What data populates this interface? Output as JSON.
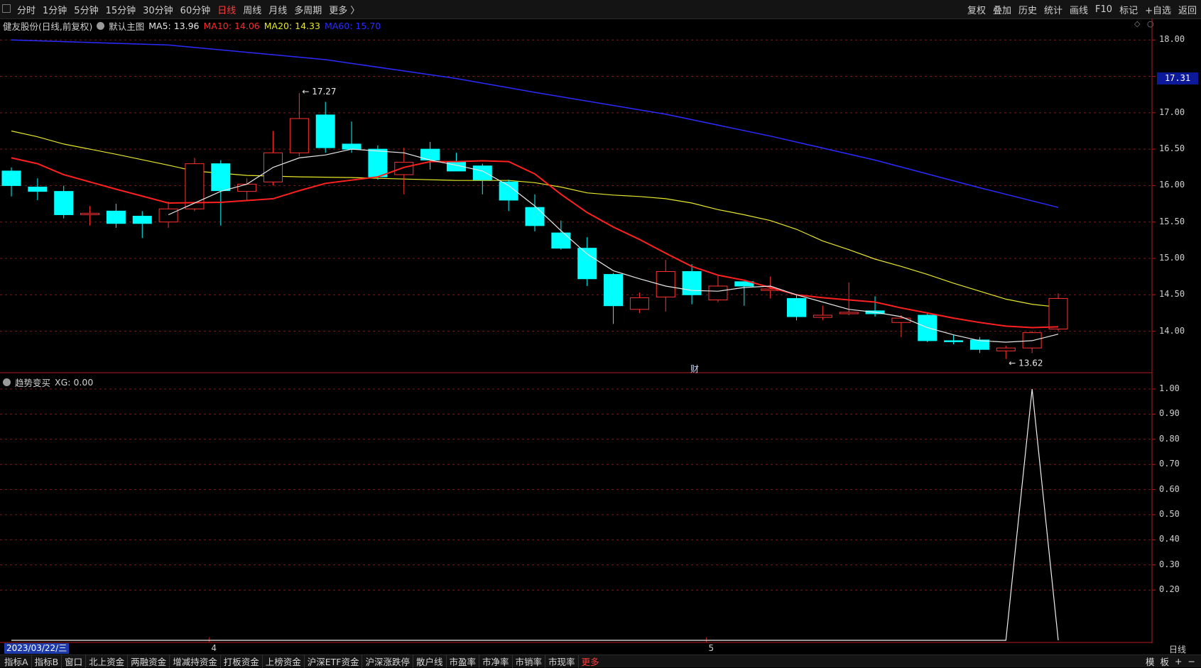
{
  "toolbar": {
    "periods": [
      "分时",
      "1分钟",
      "5分钟",
      "15分钟",
      "30分钟",
      "60分钟",
      "日线",
      "周线",
      "月线",
      "多周期",
      "更多 〉"
    ],
    "active_period": "日线",
    "tools": [
      "复权",
      "叠加",
      "历史",
      "统计",
      "画线",
      "F10",
      "标记",
      "+自选",
      "返回"
    ]
  },
  "info": {
    "stock": "健友股份(日线,前复权)",
    "template": "默认主图",
    "ma": [
      {
        "label": "MA5: 13.96",
        "color": "#e8e8e8"
      },
      {
        "label": "MA10: 14.06",
        "color": "#ff2a2a"
      },
      {
        "label": "MA20: 14.33",
        "color": "#e6e62a"
      },
      {
        "label": "MA60: 15.70",
        "color": "#2b2bff"
      }
    ]
  },
  "side_icons": [
    "◇",
    "○"
  ],
  "sub": {
    "name": "趋势变买",
    "value": "XG: 0.00"
  },
  "badge": "财",
  "price_axis": [
    "18.00",
    "17.50",
    "17.00",
    "16.50",
    "16.00",
    "15.50",
    "15.00",
    "14.50",
    "14.00"
  ],
  "current_price": "17.31",
  "sub_axis": [
    "1.00",
    "0.90",
    "0.80",
    "0.70",
    "0.60",
    "0.50",
    "0.40",
    "0.30",
    "0.20"
  ],
  "annotations": {
    "high": "17.27",
    "low": "13.62"
  },
  "month_marks": [
    "4",
    "5"
  ],
  "cursor_date": "2023/03/22/三",
  "period_tag": "日线",
  "bottom": {
    "tabs": [
      "指标A",
      "指标B",
      "窗口",
      "北上资金",
      "两融资金",
      "增减持资金",
      "打板资金",
      "上榜资金",
      "沪深ETF资金",
      "沪深涨跌停",
      "散户线",
      "市盈率",
      "市净率",
      "市销率",
      "市现率"
    ],
    "more": "更多",
    "right": [
      "模",
      "板",
      "+",
      "−"
    ]
  },
  "colors": {
    "up": "#ff3232",
    "down": "#00ffff",
    "ma5": "#e8e8e8",
    "ma10": "#ff2020",
    "ma20": "#e6e62a",
    "ma60": "#2b2bff",
    "grid": "#7a1a1a"
  },
  "chart_data": {
    "type": "candlestick",
    "y_range": [
      13.45,
      18.1
    ],
    "candles": [
      {
        "o": 16.2,
        "h": 16.25,
        "l": 15.85,
        "c": 16.0
      },
      {
        "o": 15.98,
        "h": 16.1,
        "l": 15.8,
        "c": 15.92
      },
      {
        "o": 15.92,
        "h": 16.0,
        "l": 15.55,
        "c": 15.6
      },
      {
        "o": 15.6,
        "h": 15.72,
        "l": 15.45,
        "c": 15.62
      },
      {
        "o": 15.65,
        "h": 15.75,
        "l": 15.42,
        "c": 15.48
      },
      {
        "o": 15.58,
        "h": 15.65,
        "l": 15.28,
        "c": 15.48
      },
      {
        "o": 15.5,
        "h": 15.78,
        "l": 15.42,
        "c": 15.68
      },
      {
        "o": 15.68,
        "h": 16.38,
        "l": 15.65,
        "c": 16.3
      },
      {
        "o": 16.3,
        "h": 16.35,
        "l": 15.45,
        "c": 15.93
      },
      {
        "o": 15.92,
        "h": 16.1,
        "l": 15.8,
        "c": 16.02
      },
      {
        "o": 16.05,
        "h": 16.75,
        "l": 16.0,
        "c": 16.45
      },
      {
        "o": 16.45,
        "h": 17.27,
        "l": 16.4,
        "c": 16.92
      },
      {
        "o": 16.97,
        "h": 17.15,
        "l": 16.45,
        "c": 16.52
      },
      {
        "o": 16.57,
        "h": 16.88,
        "l": 16.45,
        "c": 16.5
      },
      {
        "o": 16.5,
        "h": 16.55,
        "l": 16.08,
        "c": 16.12
      },
      {
        "o": 16.15,
        "h": 16.52,
        "l": 15.88,
        "c": 16.32
      },
      {
        "o": 16.5,
        "h": 16.6,
        "l": 16.22,
        "c": 16.35
      },
      {
        "o": 16.33,
        "h": 16.45,
        "l": 16.2,
        "c": 16.2
      },
      {
        "o": 16.27,
        "h": 16.3,
        "l": 15.88,
        "c": 16.08
      },
      {
        "o": 16.05,
        "h": 16.08,
        "l": 15.65,
        "c": 15.8
      },
      {
        "o": 15.7,
        "h": 15.88,
        "l": 15.37,
        "c": 15.45
      },
      {
        "o": 15.35,
        "h": 15.52,
        "l": 15.12,
        "c": 15.14
      },
      {
        "o": 15.14,
        "h": 15.29,
        "l": 14.62,
        "c": 14.72
      },
      {
        "o": 14.78,
        "h": 14.8,
        "l": 14.1,
        "c": 14.35
      },
      {
        "o": 14.3,
        "h": 14.53,
        "l": 14.25,
        "c": 14.46
      },
      {
        "o": 14.47,
        "h": 14.98,
        "l": 14.27,
        "c": 14.82
      },
      {
        "o": 14.82,
        "h": 14.92,
        "l": 14.37,
        "c": 14.5
      },
      {
        "o": 14.43,
        "h": 14.76,
        "l": 14.4,
        "c": 14.62
      },
      {
        "o": 14.68,
        "h": 14.68,
        "l": 14.35,
        "c": 14.62
      },
      {
        "o": 14.56,
        "h": 14.75,
        "l": 14.45,
        "c": 14.58
      },
      {
        "o": 14.45,
        "h": 14.5,
        "l": 14.15,
        "c": 14.2
      },
      {
        "o": 14.19,
        "h": 14.35,
        "l": 14.15,
        "c": 14.22
      },
      {
        "o": 14.24,
        "h": 14.67,
        "l": 14.22,
        "c": 14.26
      },
      {
        "o": 14.28,
        "h": 14.48,
        "l": 14.2,
        "c": 14.24
      },
      {
        "o": 14.12,
        "h": 14.22,
        "l": 13.92,
        "c": 14.18
      },
      {
        "o": 14.22,
        "h": 14.25,
        "l": 13.85,
        "c": 13.87
      },
      {
        "o": 13.87,
        "h": 13.95,
        "l": 13.82,
        "c": 13.86
      },
      {
        "o": 13.88,
        "h": 13.92,
        "l": 13.7,
        "c": 13.75
      },
      {
        "o": 13.73,
        "h": 13.8,
        "l": 13.62,
        "c": 13.77
      },
      {
        "o": 13.77,
        "h": 14.0,
        "l": 13.7,
        "c": 13.98
      },
      {
        "o": 14.03,
        "h": 14.52,
        "l": 14.0,
        "c": 14.45
      }
    ],
    "ma5": [
      [
        6,
        15.6
      ],
      [
        8,
        15.92
      ],
      [
        9,
        16.02
      ],
      [
        10,
        16.25
      ],
      [
        11,
        16.38
      ],
      [
        12,
        16.42
      ],
      [
        13,
        16.5
      ],
      [
        15,
        16.45
      ],
      [
        16,
        16.35
      ],
      [
        17,
        16.28
      ],
      [
        18,
        16.2
      ],
      [
        19,
        16.0
      ],
      [
        20,
        15.72
      ],
      [
        21,
        15.38
      ],
      [
        22,
        15.06
      ],
      [
        23,
        14.83
      ],
      [
        24,
        14.72
      ],
      [
        25,
        14.62
      ],
      [
        26,
        14.56
      ],
      [
        27,
        14.55
      ],
      [
        28,
        14.6
      ],
      [
        29,
        14.62
      ],
      [
        30,
        14.5
      ],
      [
        31,
        14.4
      ],
      [
        32,
        14.3
      ],
      [
        33,
        14.26
      ],
      [
        34,
        14.2
      ],
      [
        35,
        14.05
      ],
      [
        36,
        13.95
      ],
      [
        37,
        13.87
      ],
      [
        38,
        13.85
      ],
      [
        39,
        13.87
      ],
      [
        40,
        13.96
      ]
    ],
    "ma10": [
      [
        0,
        16.38
      ],
      [
        1,
        16.3
      ],
      [
        2,
        16.15
      ],
      [
        4,
        15.95
      ],
      [
        6,
        15.76
      ],
      [
        8,
        15.77
      ],
      [
        10,
        15.82
      ],
      [
        11,
        15.93
      ],
      [
        12,
        16.03
      ],
      [
        14,
        16.12
      ],
      [
        15,
        16.25
      ],
      [
        16,
        16.33
      ],
      [
        17,
        16.33
      ],
      [
        18,
        16.34
      ],
      [
        19,
        16.33
      ],
      [
        20,
        16.16
      ],
      [
        21,
        15.88
      ],
      [
        22,
        15.63
      ],
      [
        23,
        15.43
      ],
      [
        24,
        15.26
      ],
      [
        25,
        15.07
      ],
      [
        26,
        14.89
      ],
      [
        27,
        14.77
      ],
      [
        28,
        14.7
      ],
      [
        29,
        14.6
      ],
      [
        30,
        14.5
      ],
      [
        31,
        14.46
      ],
      [
        32,
        14.43
      ],
      [
        33,
        14.4
      ],
      [
        34,
        14.32
      ],
      [
        35,
        14.25
      ],
      [
        36,
        14.18
      ],
      [
        37,
        14.12
      ],
      [
        38,
        14.07
      ],
      [
        39,
        14.05
      ],
      [
        40,
        14.06
      ]
    ],
    "ma20": [
      [
        0,
        16.75
      ],
      [
        1,
        16.67
      ],
      [
        2,
        16.57
      ],
      [
        4,
        16.43
      ],
      [
        6,
        16.28
      ],
      [
        7,
        16.2
      ],
      [
        8,
        16.17
      ],
      [
        9,
        16.14
      ],
      [
        11,
        16.12
      ],
      [
        13,
        16.11
      ],
      [
        15,
        16.09
      ],
      [
        17,
        16.07
      ],
      [
        19,
        16.07
      ],
      [
        20,
        16.04
      ],
      [
        21,
        15.98
      ],
      [
        22,
        15.9
      ],
      [
        23,
        15.87
      ],
      [
        24,
        15.85
      ],
      [
        25,
        15.82
      ],
      [
        26,
        15.76
      ],
      [
        27,
        15.67
      ],
      [
        28,
        15.6
      ],
      [
        29,
        15.52
      ],
      [
        30,
        15.4
      ],
      [
        31,
        15.24
      ],
      [
        32,
        15.12
      ],
      [
        33,
        14.99
      ],
      [
        34,
        14.89
      ],
      [
        35,
        14.78
      ],
      [
        36,
        14.66
      ],
      [
        37,
        14.55
      ],
      [
        38,
        14.44
      ],
      [
        39,
        14.37
      ],
      [
        40,
        14.33
      ]
    ],
    "ma60": [
      [
        0,
        18.0
      ],
      [
        6,
        17.93
      ],
      [
        12,
        17.73
      ],
      [
        17,
        17.47
      ],
      [
        20,
        17.28
      ],
      [
        25,
        16.98
      ],
      [
        29,
        16.68
      ],
      [
        33,
        16.35
      ],
      [
        37,
        15.97
      ],
      [
        40,
        15.7
      ]
    ],
    "indicator": {
      "name": "XG",
      "y_range": [
        0,
        1.0
      ],
      "values": [
        [
          0,
          0
        ],
        [
          38,
          0
        ],
        [
          39,
          1
        ],
        [
          40,
          0
        ]
      ]
    }
  }
}
